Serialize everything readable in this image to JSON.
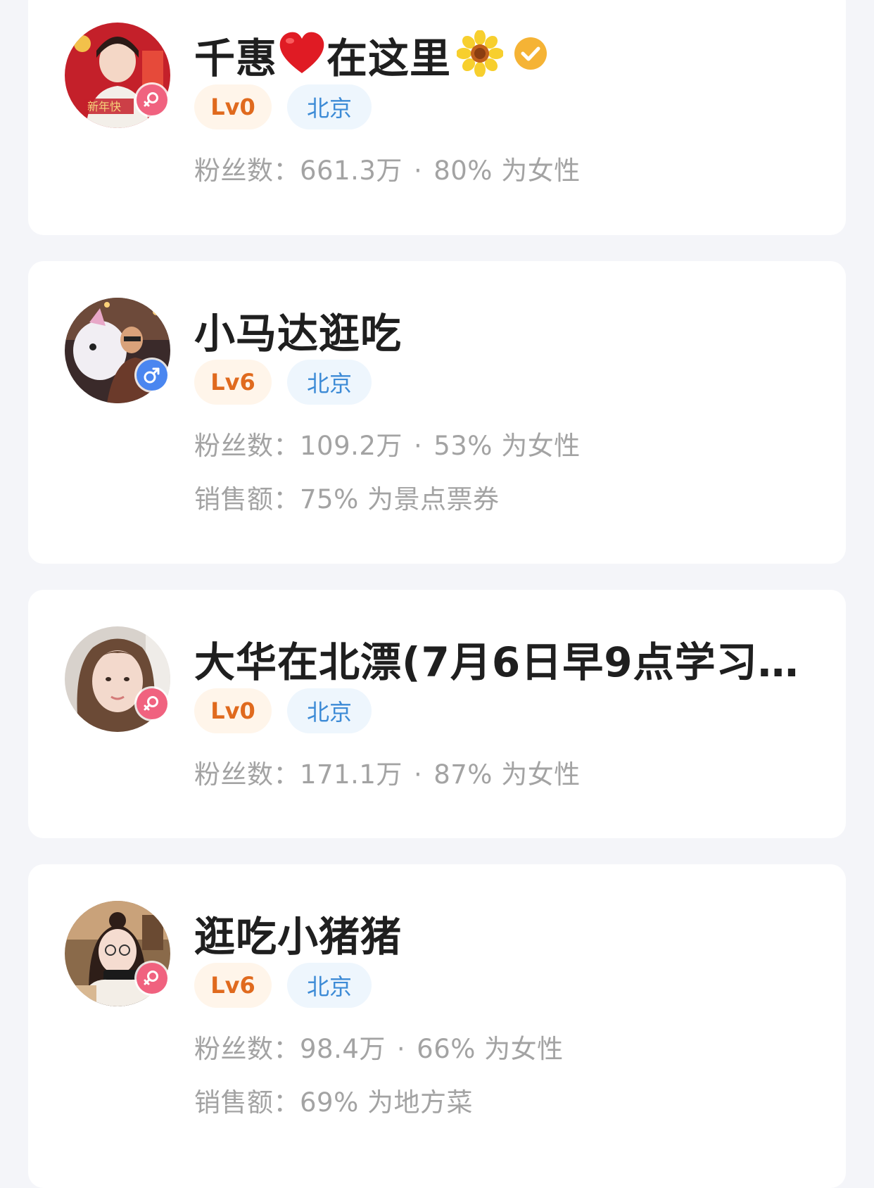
{
  "cards": [
    {
      "name_part1": "千惠",
      "name_part2": "在这里",
      "level": "Lv0",
      "city": "北京",
      "fans_label": "粉丝数：",
      "fans_count": "661.3万",
      "separator": "·",
      "gender_ratio": "80% 为女性",
      "gender": "female",
      "verified": true
    },
    {
      "name": "小马达逛吃",
      "level": "Lv6",
      "city": "北京",
      "fans_label": "粉丝数：",
      "fans_count": "109.2万",
      "separator": "·",
      "gender_ratio": "53% 为女性",
      "sales_label": "销售额：",
      "sales_value": "75% 为景点票券",
      "gender": "male"
    },
    {
      "name": "大华在北漂(7月6日早9点学习...",
      "level": "Lv0",
      "city": "北京",
      "fans_label": "粉丝数：",
      "fans_count": "171.1万",
      "separator": "·",
      "gender_ratio": "87% 为女性",
      "gender": "female"
    },
    {
      "name": "逛吃小猪猪",
      "level": "Lv6",
      "city": "北京",
      "fans_label": "粉丝数：",
      "fans_count": "98.4万",
      "separator": "·",
      "gender_ratio": "66% 为女性",
      "sales_label": "销售额：",
      "sales_value": "69% 为地方菜",
      "gender": "female"
    }
  ],
  "colors": {
    "page_bg": "#f4f5f9",
    "card_bg": "#ffffff",
    "level_text": "#e06a1e",
    "level_bg": "#fff5ea",
    "city_text": "#3d8bd6",
    "city_bg": "#eef6fd",
    "stat_text": "#a3a3a3",
    "female_badge": "#f0627f",
    "male_badge": "#4a86f0",
    "verified": "#f5b335"
  },
  "icons": {
    "heart": "heart-emoji-icon",
    "flower": "sunflower-emoji-icon",
    "verified": "verified-badge-icon",
    "female": "female-gender-icon",
    "male": "male-gender-icon"
  }
}
